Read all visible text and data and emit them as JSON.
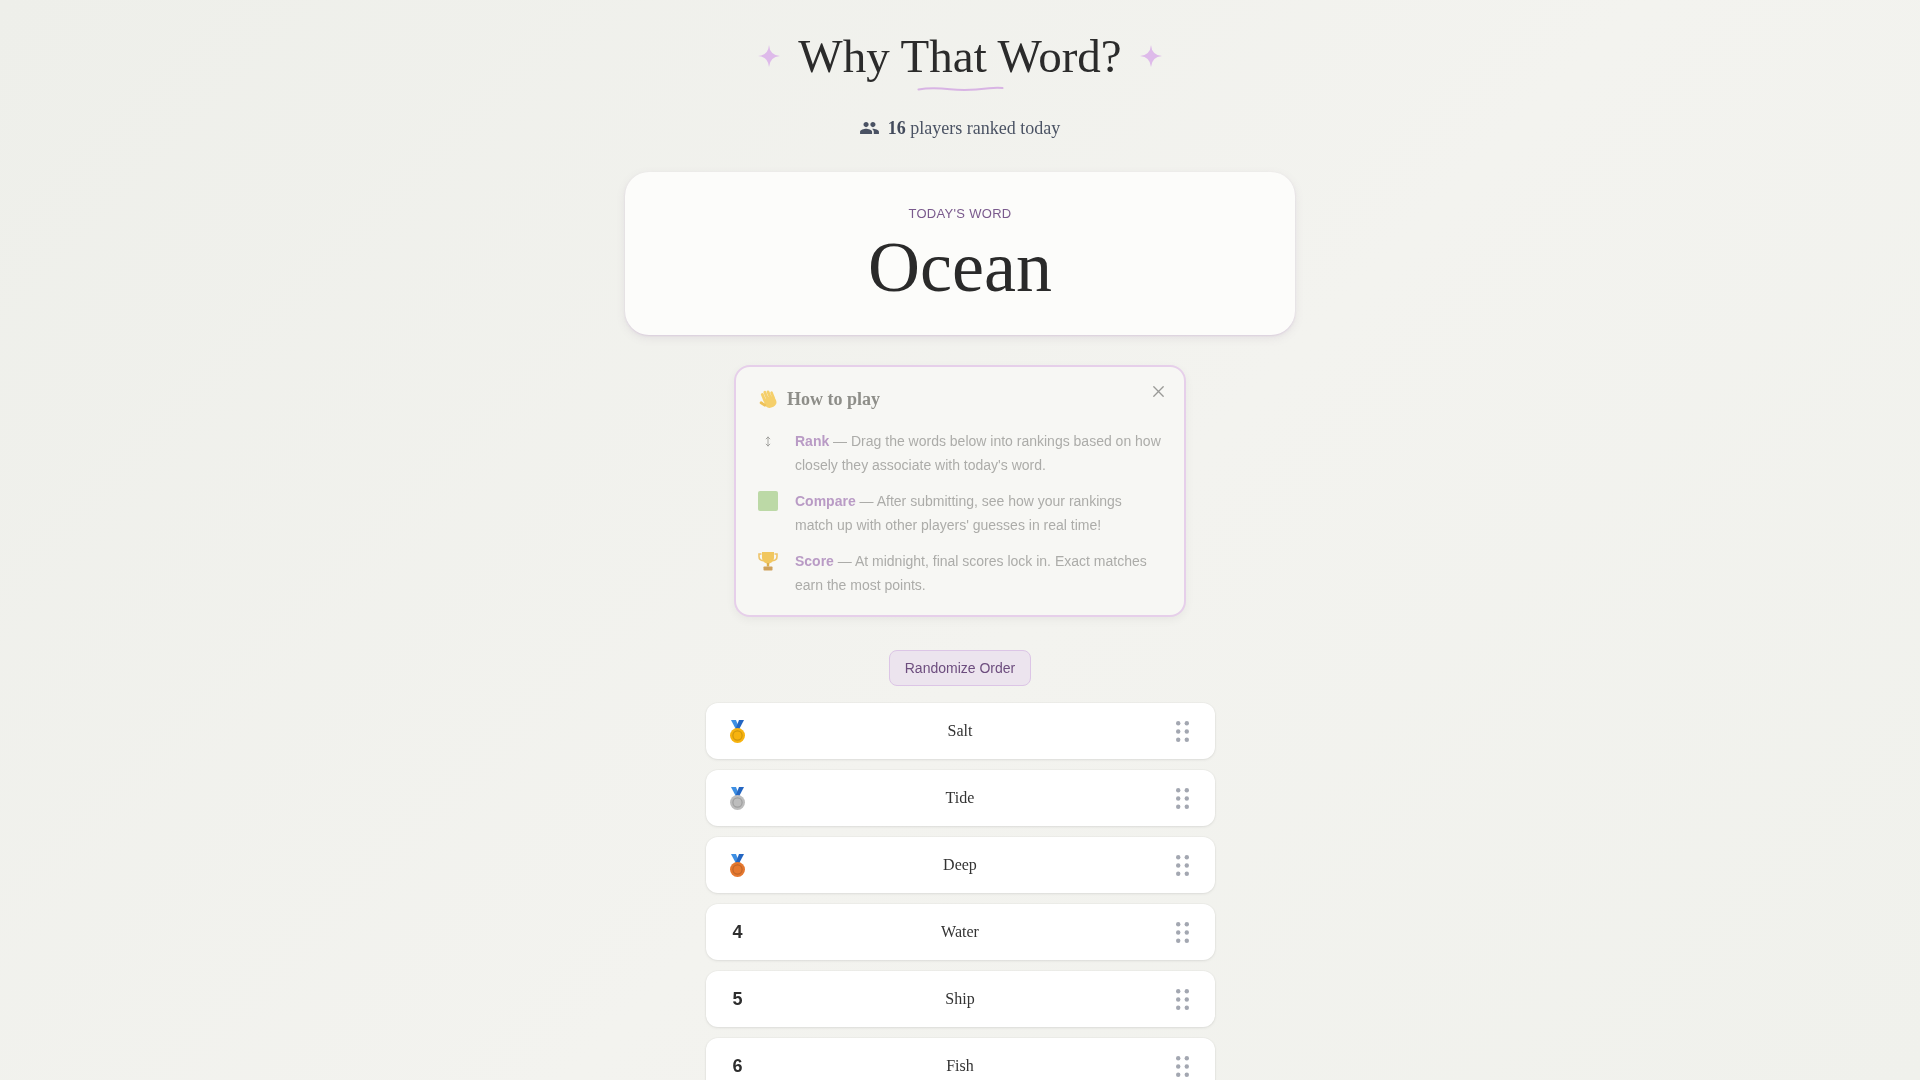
{
  "header": {
    "title": "Why That Word?",
    "players": "**16** players ranked today"
  },
  "word_card": {
    "label": "TODAY'S WORD",
    "word": "Ocean"
  },
  "how_to_play": {
    "title": "How to play",
    "rules": [
      {
        "text": "**Rank** — Drag the words below into rankings based on how closely they associate with today's word."
      },
      {
        "text": "**Compare** — After submitting, see how your rankings match up with other players' guesses in real time!"
      },
      {
        "text": "**Score** — At midnight, final scores lock in. Exact matches earn the most points."
      }
    ]
  },
  "randomize_button": "Randomize Order",
  "rankings": [
    {
      "kind": "medal",
      "color": "#f7b30f",
      "word": "Salt"
    },
    {
      "kind": "medal",
      "color": "#bdbdbd",
      "word": "Tide"
    },
    {
      "kind": "medal",
      "color": "#e5782f",
      "word": "Deep"
    },
    {
      "kind": "number",
      "rank": "4",
      "word": "Water"
    },
    {
      "kind": "number",
      "rank": "5",
      "word": "Ship"
    },
    {
      "kind": "number",
      "rank": "6",
      "word": "Fish"
    }
  ]
}
